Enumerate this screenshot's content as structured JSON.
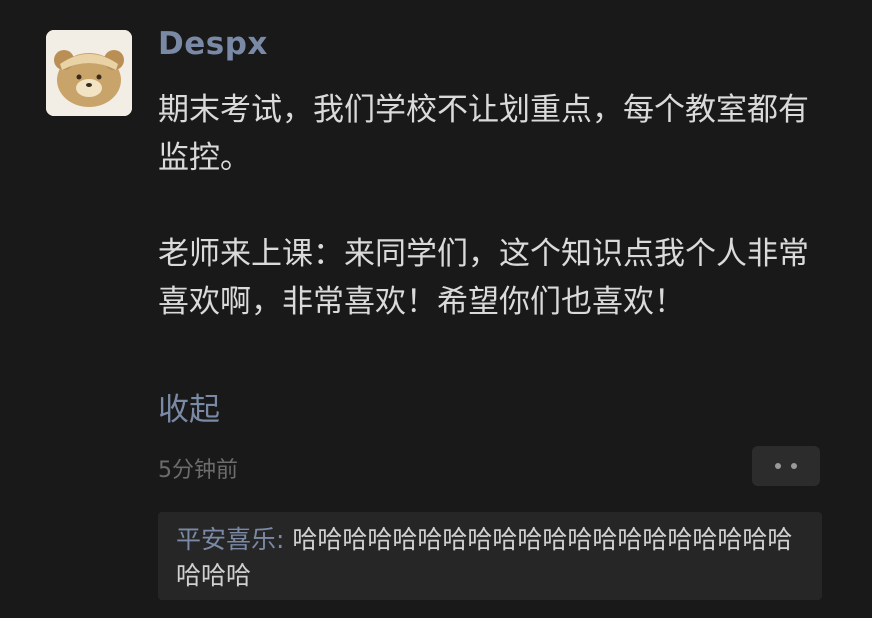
{
  "post": {
    "nickname": "Despx",
    "avatar_icon": "bear-avatar-icon",
    "paragraph1": "期末考试，我们学校不让划重点，每个教室都有监控。",
    "paragraph2": "老师来上课：来同学们，这个知识点我个人非常喜欢啊，非常喜欢！希望你们也喜欢！",
    "collapse_label": "收起",
    "time": "5分钟前",
    "more_icon": "more-dots-icon"
  },
  "comment": {
    "author": "平安喜乐",
    "separator": ": ",
    "text": "哈哈哈哈哈哈哈哈哈哈哈哈哈哈哈哈哈哈哈哈哈哈哈"
  },
  "colors": {
    "background": "#191919",
    "link_blue": "#7a8aa6",
    "text": "#dadada",
    "comment_bg": "#262626"
  }
}
